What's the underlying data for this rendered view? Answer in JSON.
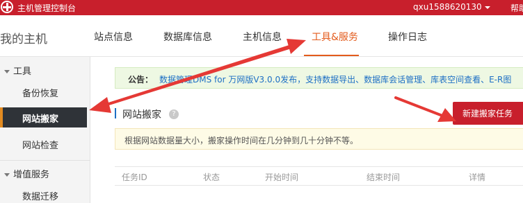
{
  "topbar": {
    "title": "主机管理控制台",
    "user": "qxu1588620130",
    "help": "帮助"
  },
  "header": {
    "page_title": "我的主机",
    "tabs": [
      {
        "label": "站点信息",
        "active": false
      },
      {
        "label": "数据库信息",
        "active": false
      },
      {
        "label": "主机信息",
        "active": false
      },
      {
        "label": "工具&服务",
        "active": true
      },
      {
        "label": "操作日志",
        "active": false
      }
    ]
  },
  "sidebar": {
    "groups": [
      {
        "label": "工具",
        "items": [
          "备份恢复",
          "网站搬家",
          "网站检查"
        ]
      },
      {
        "label": "增值服务",
        "items": [
          "数据迁移"
        ]
      }
    ],
    "active_item": "网站搬家"
  },
  "notice": {
    "label": "公告：",
    "text": "数据管理DMS for 万网版V3.0.0发布，支持数据导出、数据库会话管理、库表空间查看、E-R图"
  },
  "section": {
    "title": "网站搬家",
    "help_icon": "?",
    "new_task_button": "新建搬家任务",
    "tip": "根据网站数据量大小，搬家操作时间在几分钟到几十分钟不等。"
  },
  "table": {
    "columns": [
      "任务ID",
      "状态",
      "开始时间",
      "结束时间",
      "详情"
    ]
  },
  "colors": {
    "brand_red": "#c81f2c",
    "active_tab": "#e35b1c",
    "link_blue": "#1d6fc4",
    "sidebar_active_bg": "#2f3338",
    "sidebar_active_accent": "#e38b21"
  }
}
